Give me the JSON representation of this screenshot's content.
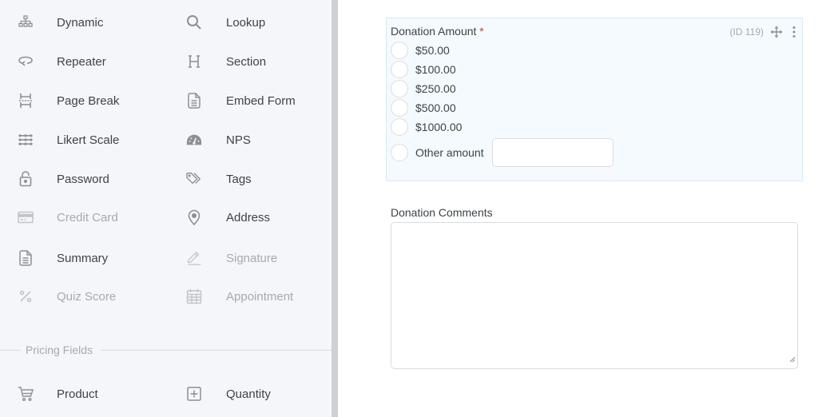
{
  "sidebar": {
    "fields": [
      {
        "label": "Dynamic",
        "icon": "sitemap-icon",
        "disabled": false
      },
      {
        "label": "Lookup",
        "icon": "search-icon",
        "disabled": false
      },
      {
        "label": "Repeater",
        "icon": "repeat-icon",
        "disabled": false
      },
      {
        "label": "Section",
        "icon": "heading-icon",
        "disabled": false
      },
      {
        "label": "Page Break",
        "icon": "page-break-icon",
        "disabled": false
      },
      {
        "label": "Embed Form",
        "icon": "file-text-icon",
        "disabled": false
      },
      {
        "label": "Likert Scale",
        "icon": "likert-icon",
        "disabled": false
      },
      {
        "label": "NPS",
        "icon": "gauge-icon",
        "disabled": false
      },
      {
        "label": "Password",
        "icon": "lock-icon",
        "disabled": false
      },
      {
        "label": "Tags",
        "icon": "tags-icon",
        "disabled": false
      },
      {
        "label": "Credit Card",
        "icon": "credit-card-icon",
        "disabled": true
      },
      {
        "label": "Address",
        "icon": "map-pin-icon",
        "disabled": false
      },
      {
        "label": "Summary",
        "icon": "file-text-icon",
        "disabled": false
      },
      {
        "label": "Signature",
        "icon": "pencil-icon",
        "disabled": true
      },
      {
        "label": "Quiz Score",
        "icon": "percent-icon",
        "disabled": true
      },
      {
        "label": "Appointment",
        "icon": "calendar-icon",
        "disabled": true
      }
    ],
    "pricing_section": {
      "title": "Pricing Fields",
      "fields": [
        {
          "label": "Product",
          "icon": "cart-icon"
        },
        {
          "label": "Quantity",
          "icon": "plus-square-icon"
        }
      ]
    }
  },
  "form": {
    "donation_amount": {
      "label": "Donation Amount",
      "required_mark": "*",
      "meta": "(ID 119)",
      "options": [
        "$50.00",
        "$100.00",
        "$250.00",
        "$500.00",
        "$1000.00"
      ],
      "other_label": "Other amount",
      "other_value": ""
    },
    "donation_comments": {
      "label": "Donation Comments",
      "value": ""
    }
  },
  "colors": {
    "sidebar_bg": "#f5f6fa",
    "selected_field_bg": "#f5faff",
    "selected_field_border": "#d7e8fb",
    "required": "#d63638",
    "text": "#3c434a",
    "muted": "#a7aaad"
  }
}
